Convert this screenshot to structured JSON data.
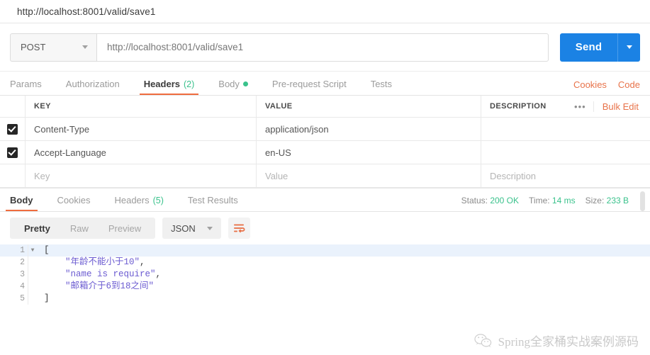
{
  "titlebar": {
    "url": "http://localhost:8001/valid/save1"
  },
  "request": {
    "method": "POST",
    "url": "http://localhost:8001/valid/save1",
    "send_label": "Send",
    "tabs": [
      {
        "label": "Params",
        "active": false
      },
      {
        "label": "Authorization",
        "active": false
      },
      {
        "label": "Headers",
        "count": "(2)",
        "active": true
      },
      {
        "label": "Body",
        "dot": true,
        "active": false
      },
      {
        "label": "Pre-request Script",
        "active": false
      },
      {
        "label": "Tests",
        "active": false
      }
    ],
    "right_links": [
      "Cookies",
      "Code"
    ]
  },
  "headers_table": {
    "columns": [
      "KEY",
      "VALUE",
      "DESCRIPTION"
    ],
    "more_label": "•••",
    "bulk_edit_label": "Bulk Edit",
    "rows": [
      {
        "checked": true,
        "key": "Content-Type",
        "value": "application/json",
        "description": ""
      },
      {
        "checked": true,
        "key": "Accept-Language",
        "value": "en-US",
        "description": ""
      }
    ],
    "placeholder_row": {
      "key": "Key",
      "value": "Value",
      "description": "Description"
    }
  },
  "response": {
    "tabs": [
      {
        "label": "Body",
        "active": true
      },
      {
        "label": "Cookies",
        "active": false
      },
      {
        "label": "Headers",
        "count": "(5)",
        "active": false
      },
      {
        "label": "Test Results",
        "active": false
      }
    ],
    "meta": {
      "status_label": "Status:",
      "status_value": "200 OK",
      "time_label": "Time:",
      "time_value": "14 ms",
      "size_label": "Size:",
      "size_value": "233 B"
    },
    "format_tabs": [
      {
        "label": "Pretty",
        "active": true
      },
      {
        "label": "Raw",
        "active": false
      },
      {
        "label": "Preview",
        "active": false
      }
    ],
    "language": "JSON",
    "wrap_icon": "word-wrap-icon",
    "body_lines": [
      {
        "n": "1",
        "foldable": true,
        "pre": "",
        "str": "",
        "post": "["
      },
      {
        "n": "2",
        "foldable": false,
        "pre": "    ",
        "str": "\"年龄不能小于10\"",
        "post": ","
      },
      {
        "n": "3",
        "foldable": false,
        "pre": "    ",
        "str": "\"name is require\"",
        "post": ","
      },
      {
        "n": "4",
        "foldable": false,
        "pre": "    ",
        "str": "\"邮箱介于6到18之间\"",
        "post": ""
      },
      {
        "n": "5",
        "foldable": false,
        "pre": "",
        "str": "",
        "post": "]"
      }
    ]
  },
  "watermark": {
    "text": "Spring全家桶实战案例源码",
    "icon": "wechat-icon"
  },
  "colors": {
    "accent_orange": "#ef6c3e",
    "link_orange": "#e8734a",
    "send_blue": "#1b82e4",
    "success_green": "#3ac28c",
    "string_purple": "#6b5bd1"
  }
}
